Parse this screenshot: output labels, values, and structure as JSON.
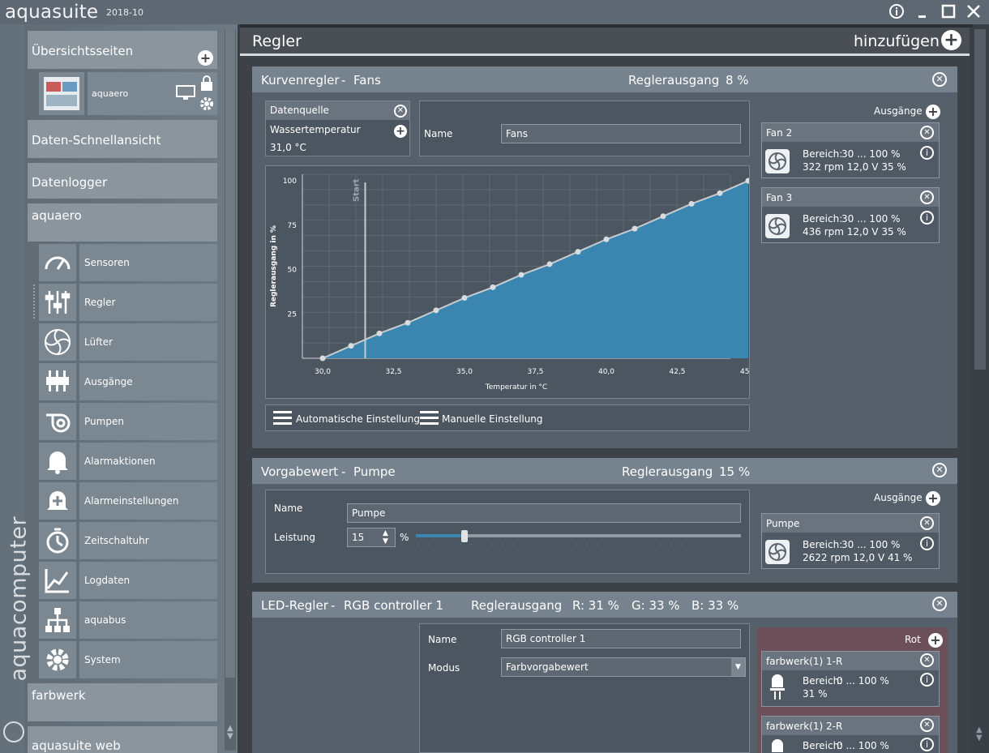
{
  "app": {
    "title": "aquasuite",
    "version": "2018-10",
    "brand_vertical": "aquacomputer"
  },
  "sidebar": {
    "overview": "Übersichtsseiten",
    "overview_item": "aquaero",
    "quick_view": "Daten-Schnellansicht",
    "logger": "Datenlogger",
    "aquaero": "aquaero",
    "items": [
      {
        "label": "Sensoren",
        "icon": "gauge-icon"
      },
      {
        "label": "Regler",
        "icon": "sliders-icon"
      },
      {
        "label": "Lüfter",
        "icon": "fan-icon"
      },
      {
        "label": "Ausgänge",
        "icon": "outputs-icon"
      },
      {
        "label": "Pumpen",
        "icon": "pump-icon"
      },
      {
        "label": "Alarmaktionen",
        "icon": "bell-icon"
      },
      {
        "label": "Alarmeinstellungen",
        "icon": "bell-plus-icon"
      },
      {
        "label": "Zeitschaltuhr",
        "icon": "timer-icon"
      },
      {
        "label": "Logdaten",
        "icon": "chart-icon"
      },
      {
        "label": "aquabus",
        "icon": "network-icon"
      },
      {
        "label": "System",
        "icon": "gear-icon"
      }
    ],
    "farbwerk": "farbwerk",
    "web": "aquasuite web"
  },
  "main": {
    "title": "Regler",
    "add": "hinzufügen"
  },
  "panel1": {
    "type": "Kurvenregler",
    "sep": "-",
    "name": "Fans",
    "out_label": "Reglerausgang",
    "out_value": "8 %",
    "source_title": "Datenquelle",
    "source_name": "Wassertemperatur",
    "source_value": "31,0 °C",
    "name_label": "Name",
    "name_value": "Fans",
    "outputs_label": "Ausgänge",
    "outputs": [
      {
        "name": "Fan 2",
        "range_label": "Bereich:",
        "range": "30 ... 100  %",
        "stats": "322 rpm  12,0 V  35 %"
      },
      {
        "name": "Fan 3",
        "range_label": "Bereich:",
        "range": "30 ... 100  %",
        "stats": "436 rpm  12,0 V  35 %"
      }
    ],
    "auto_label": "Automatische Einstellung",
    "manual_label": "Manuelle Einstellung"
  },
  "chart_data": {
    "type": "area",
    "x": [
      30.0,
      31.0,
      32.0,
      33.0,
      34.0,
      35.0,
      36.0,
      37.0,
      38.0,
      39.0,
      40.0,
      41.0,
      42.0,
      43.0,
      44.0,
      45.0
    ],
    "y": [
      0,
      7,
      14,
      20,
      27,
      34,
      40,
      47,
      53,
      60,
      67,
      73,
      80,
      87,
      93,
      100
    ],
    "xlabel": "Temperatur in °C",
    "ylabel": "Reglerausgang in %",
    "xlim": [
      30,
      45
    ],
    "ylim": [
      0,
      100
    ],
    "xticks": [
      "30,0",
      "32,5",
      "35,0",
      "37,5",
      "40,0",
      "42,5",
      "45,0"
    ],
    "yticks": [
      "25",
      "50",
      "75",
      "100"
    ],
    "marker_label": "Start",
    "marker_x": 31.5,
    "fill": "#3a86b0",
    "line": "#c8ccd0"
  },
  "panel2": {
    "type": "Vorgabewert",
    "sep": "-",
    "name": "Pumpe",
    "out_label": "Reglerausgang",
    "out_value": "15 %",
    "name_label": "Name",
    "name_value": "Pumpe",
    "power_label": "Leistung",
    "power_value": "15",
    "power_unit": "%",
    "power_fraction": 0.15,
    "outputs_label": "Ausgänge",
    "output": {
      "name": "Pumpe",
      "range_label": "Bereich:",
      "range": "30 ... 100  %",
      "stats": "2622 rpm  12,0 V  41 %"
    }
  },
  "panel3": {
    "type": "LED-Regler",
    "sep": "-",
    "name": "RGB controller 1",
    "out_label": "Reglerausgang",
    "r": "R: 31 %",
    "g": "G: 33 %",
    "b": "B: 33 %",
    "name_label": "Name",
    "name_value": "RGB controller 1",
    "mode_label": "Modus",
    "mode_value": "Farbvorgabewert",
    "red_label": "Rot",
    "outputs": [
      {
        "name": "farbwerk(1) 1-R",
        "range_label": "Bereich:",
        "range": "0 ... 100  %",
        "value": "31 %"
      },
      {
        "name": "farbwerk(1) 2-R",
        "range_label": "Bereich:",
        "range": "0 ... 100  %"
      }
    ]
  }
}
